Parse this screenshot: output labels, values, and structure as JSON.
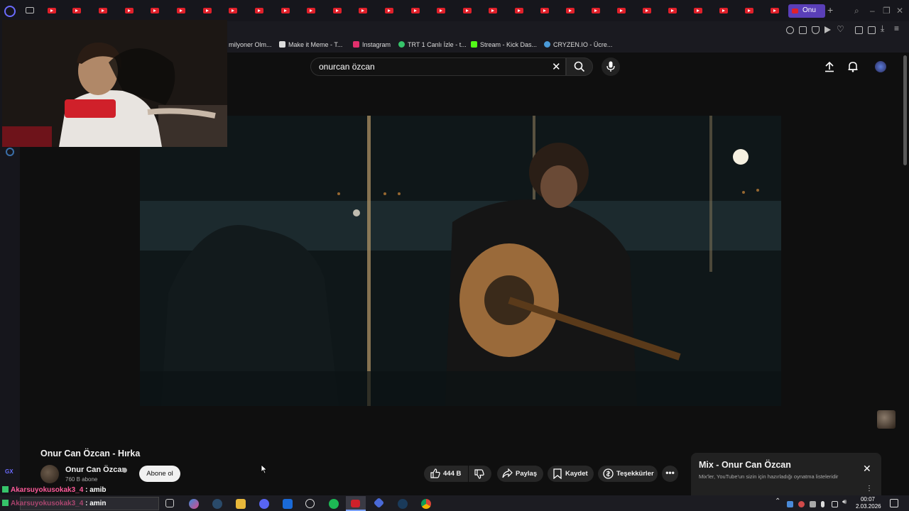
{
  "browser": {
    "active_tab_label": "Onu",
    "bookmarks": [
      {
        "label": "milyoner Olm...",
        "icon": "bookmark-blank-icon",
        "color": "#1a1a20"
      },
      {
        "label": "Make it Meme - T...",
        "icon": "mim-icon",
        "color": "#dddddd"
      },
      {
        "label": "Instagram",
        "icon": "instagram-icon",
        "color": "#e1306c"
      },
      {
        "label": "TRT 1 Canlı İzle - t...",
        "icon": "trt-icon",
        "color": "#36c46a"
      },
      {
        "label": "Stream - Kick Das...",
        "icon": "kick-icon",
        "color": "#53fc18"
      },
      {
        "label": "CRYZEN.IO - Ücre...",
        "icon": "cryzen-icon",
        "color": "#4a9ad8"
      }
    ]
  },
  "header": {
    "search_value": "onurcan özcan"
  },
  "video": {
    "title": "Onur Can Özcan - Hırka",
    "channel_name": "Onur Can Özcan",
    "subscribers": "760 B abone",
    "subscribe_label": "Abone ol",
    "like_count": "444 B",
    "share_label": "Paylaş",
    "save_label": "Kaydet",
    "thanks_label": "Teşekkürler"
  },
  "mix": {
    "title": "Mix - Onur Can Özcan",
    "subtitle": "Mix'ler, YouTube'un sizin için hazırladığı oynatma listeleridir"
  },
  "chat": [
    {
      "user": "Akarsuyokusokak3_4",
      "message": "amib"
    },
    {
      "user": "Akarsuyokusokak3_4",
      "message": "amin"
    }
  ],
  "taskbar": {
    "time": "00:07",
    "date": "2.03.2026"
  },
  "colors": {
    "youtube_red": "#e0202a",
    "opera_accent": "#5a3fb8"
  }
}
